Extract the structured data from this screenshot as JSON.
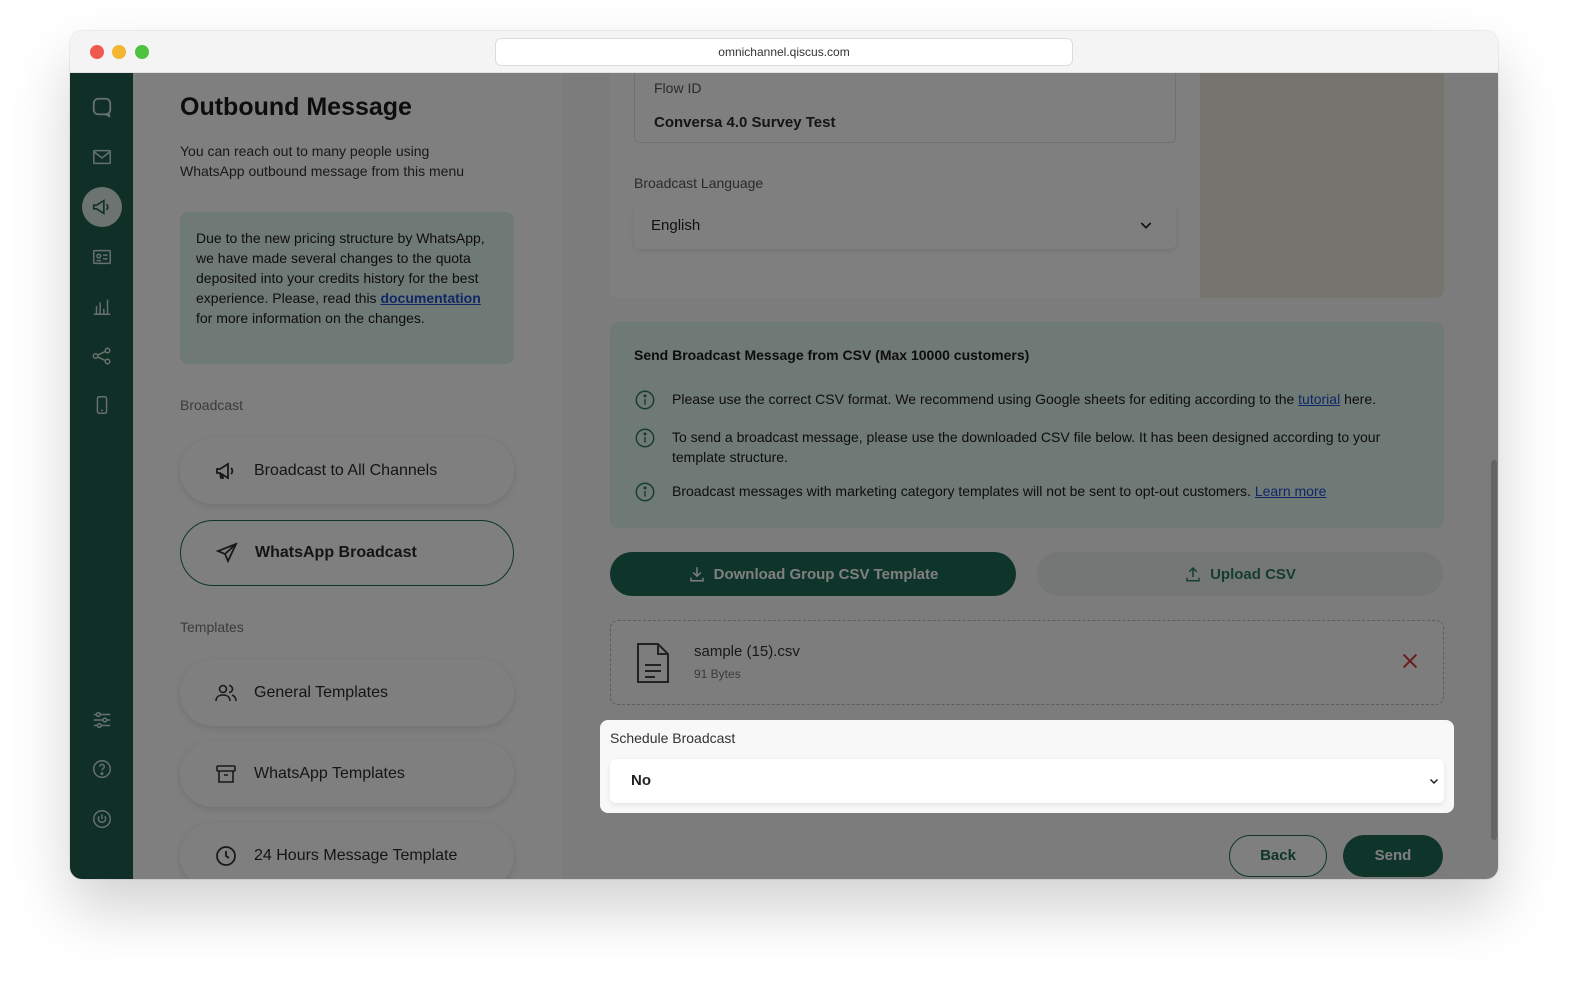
{
  "browser": {
    "url": "omnichannel.qiscus.com"
  },
  "sidebar": {
    "page_title": "Outbound Message",
    "page_desc": "You can reach out to many people using WhatsApp outbound message from this menu",
    "notice": {
      "text_before": "Due to the new pricing structure by WhatsApp, we have made several changes to the quota deposited into your credits history for the best experience. Please, read this ",
      "link": "documentation",
      "text_after": " for more information on the changes."
    },
    "broadcast_label": "Broadcast",
    "broadcast_items": [
      {
        "label": "Broadcast to All Channels",
        "icon": "megaphone-icon"
      },
      {
        "label": "WhatsApp Broadcast",
        "icon": "send-icon"
      }
    ],
    "templates_label": "Templates",
    "template_items": [
      {
        "label": "General Templates",
        "icon": "users-icon"
      },
      {
        "label": "WhatsApp Templates",
        "icon": "archive-icon"
      },
      {
        "label": "24 Hours Message Template",
        "icon": "clock-icon"
      }
    ]
  },
  "form": {
    "flow_id_label": "Flow ID",
    "flow_id_value": "Conversa 4.0 Survey Test",
    "language_label": "Broadcast Language",
    "language_value": "English"
  },
  "csv": {
    "title": "Send Broadcast Message from CSV (Max 10000 customers)",
    "row1_before": "Please use the correct CSV format. We recommend using Google sheets for editing according to the ",
    "row1_link": "tutorial",
    "row1_after": " here.",
    "row2": "To send a broadcast message, please use the downloaded CSV file below. It has been designed according to your template structure.",
    "row3_before": "Broadcast messages with marketing category templates will not be sent to opt-out customers. ",
    "row3_link": "Learn more",
    "download_label": "Download Group CSV Template",
    "upload_label": "Upload CSV"
  },
  "file": {
    "name": "sample (15).csv",
    "size": "91 Bytes"
  },
  "schedule": {
    "label": "Schedule Broadcast",
    "value": "No"
  },
  "actions": {
    "back": "Back",
    "send": "Send"
  },
  "colors": {
    "brand": "#1f6b56",
    "rail": "#1f5f4f",
    "notice_bg": "#dff2ea",
    "danger": "#d23b3b"
  }
}
